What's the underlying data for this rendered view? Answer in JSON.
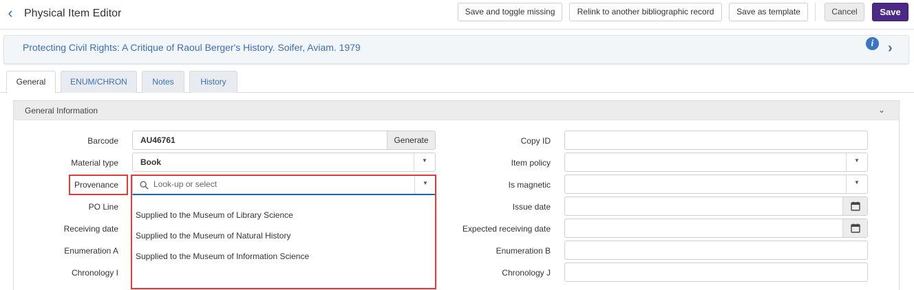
{
  "header": {
    "title": "Physical Item Editor",
    "buttons": {
      "save_toggle": "Save and toggle missing",
      "relink": "Relink to another bibliographic record",
      "save_template": "Save as template",
      "cancel": "Cancel",
      "save": "Save"
    }
  },
  "bib": {
    "title": "Protecting Civil Rights: A Critique of Raoul Berger's History. Soifer, Aviam. 1979",
    "info_glyph": "i"
  },
  "tabs": [
    "General",
    "ENUM/CHRON",
    "Notes",
    "History"
  ],
  "section": {
    "title": "General Information"
  },
  "left_fields": {
    "barcode": {
      "label": "Barcode",
      "value": "AU46761",
      "button": "Generate"
    },
    "material_type": {
      "label": "Material type",
      "value": "Book"
    },
    "provenance": {
      "label": "Provenance",
      "placeholder": "Look-up or select"
    },
    "po_line": {
      "label": "PO Line"
    },
    "receiving_date": {
      "label": "Receiving date"
    },
    "enumeration_a": {
      "label": "Enumeration A"
    },
    "chronology_i": {
      "label": "Chronology I"
    }
  },
  "provenance_options": [
    "Supplied to the Museum of Library Science",
    "Supplied to the Museum of Natural History",
    "Supplied to the Museum of Information Science"
  ],
  "right_fields": {
    "copy_id": {
      "label": "Copy ID",
      "value": ""
    },
    "item_policy": {
      "label": "Item policy",
      "value": ""
    },
    "is_magnetic": {
      "label": "Is magnetic",
      "value": ""
    },
    "issue_date": {
      "label": "Issue date",
      "value": ""
    },
    "expected_receiving_date": {
      "label": "Expected receiving date",
      "value": ""
    },
    "enumeration_b": {
      "label": "Enumeration B",
      "value": ""
    },
    "chronology_j": {
      "label": "Chronology J",
      "value": ""
    }
  },
  "colors": {
    "primary": "#4b2a85",
    "link": "#3a6fb5",
    "highlight": "#e03c3c"
  },
  "icons": [
    "back-icon",
    "info-icon",
    "chevron-right-icon",
    "chevron-down-icon",
    "search-icon",
    "calendar-icon"
  ]
}
